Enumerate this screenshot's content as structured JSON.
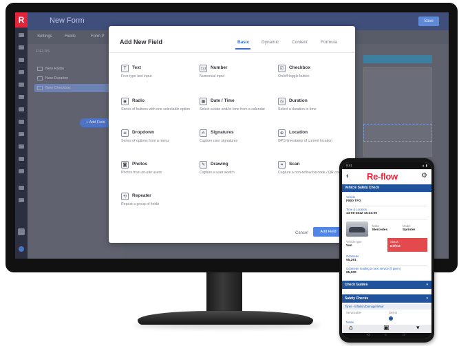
{
  "app": {
    "logo": "R",
    "title": "New Form",
    "save_label": "Save",
    "tabs": [
      "Settings",
      "Fields",
      "Form P"
    ],
    "fields_heading": "FIELDS",
    "fields": [
      "New Radio",
      "New Duration",
      "New Checkbox"
    ],
    "add_field_label": "+ Add Field"
  },
  "modal": {
    "title": "Add New Field",
    "tabs": [
      "Basic",
      "Dynamic",
      "Content",
      "Formula"
    ],
    "active_tab": "Basic",
    "field_types": [
      {
        "name": "Text",
        "desc": "Free type text input",
        "icon": "text-icon",
        "glyph": "T"
      },
      {
        "name": "Number",
        "desc": "Numerical input",
        "icon": "number-icon",
        "glyph": "123"
      },
      {
        "name": "Checkbox",
        "desc": "On/off toggle button",
        "icon": "checkbox-icon",
        "glyph": "☑"
      },
      {
        "name": "Radio",
        "desc": "Series of buttons with one selectable option",
        "icon": "radio-icon",
        "glyph": "◉"
      },
      {
        "name": "Date / Time",
        "desc": "Select a date and/or time from a calendar",
        "icon": "calendar-icon",
        "glyph": "▦"
      },
      {
        "name": "Duration",
        "desc": "Select a duration in time",
        "icon": "clock-icon",
        "glyph": "◷"
      },
      {
        "name": "Dropdown",
        "desc": "Series of options from a menu",
        "icon": "dropdown-icon",
        "glyph": "≡"
      },
      {
        "name": "Signatures",
        "desc": "Capture user signatures",
        "icon": "signature-icon",
        "glyph": "✍"
      },
      {
        "name": "Location",
        "desc": "GPS timestamp of current location",
        "icon": "location-icon",
        "glyph": "⊕"
      },
      {
        "name": "Photos",
        "desc": "Photos from on-site users",
        "icon": "camera-icon",
        "glyph": "◙"
      },
      {
        "name": "Drawing",
        "desc": "Capture a user sketch",
        "icon": "pencil-icon",
        "glyph": "✎"
      },
      {
        "name": "Scan",
        "desc": "Capture a non-reflow barcode / QR code",
        "icon": "scan-icon",
        "glyph": "⌗"
      },
      {
        "name": "Repeater",
        "desc": "Repeat a group of fields",
        "icon": "repeater-icon",
        "glyph": "⟲"
      }
    ],
    "cancel_label": "Cancel",
    "add_label": "Add Field"
  },
  "phone": {
    "status_time": "9:41",
    "status_icons": "▲ ▮",
    "logo": "Re-flow",
    "back": "‹",
    "gear": "⚙",
    "title": "Vehicle Safety Check",
    "fields": [
      {
        "label": "Vehicle",
        "value": "F800 TFG"
      },
      {
        "label": "Time & Location",
        "value": "14-06-2022 15:23:00"
      }
    ],
    "make_label": "Make",
    "make_value": "Mercedes",
    "model_label": "Model",
    "model_value": "Sprinter",
    "vehicle_type_label": "Vehicle type",
    "vehicle_type_value": "Van",
    "status_label": "Status",
    "status_value": "Defect",
    "odometer_label": "Odometer",
    "odometer_value": "55,261",
    "service_label": "Odometer reading to next service (if given)",
    "service_value": "65,000",
    "sections": [
      "Check Guides",
      "Safety Checks"
    ],
    "sub_label": "Tyres - Inflation/Damage/Wear",
    "serviceable_label": "Serviceable",
    "defect_label": "Defect",
    "notes_label": "Notes",
    "nav": [
      "◁",
      "○",
      "□"
    ]
  }
}
